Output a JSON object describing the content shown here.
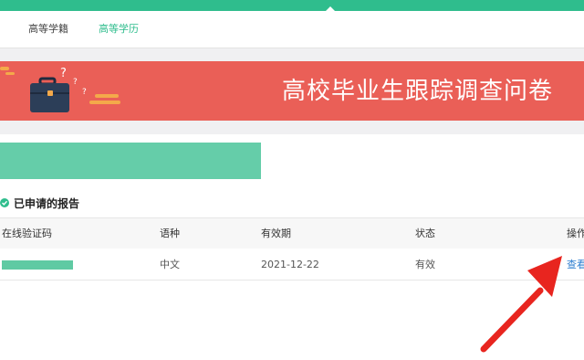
{
  "nav": {
    "tabs": [
      {
        "label": "高等学籍"
      },
      {
        "label": "高等学历"
      }
    ]
  },
  "banner": {
    "title": "高校毕业生跟踪调查问卷",
    "background": "#ea5f57",
    "decoration": [
      "briefcase-icon",
      "question-marks"
    ]
  },
  "section": {
    "title": "已申请的报告",
    "icon": "check-circle-icon"
  },
  "table": {
    "headers": [
      "在线验证码",
      "语种",
      "有效期",
      "状态",
      "操作"
    ],
    "rows": [
      {
        "code": "",
        "language": "中文",
        "validity": "2021-12-22",
        "status": "有效",
        "action": "查看"
      }
    ]
  },
  "colors": {
    "accent": "#2fbd8d",
    "banner": "#ea5f57",
    "link": "#2f7fd0",
    "annotation_arrow": "#e8251f"
  }
}
